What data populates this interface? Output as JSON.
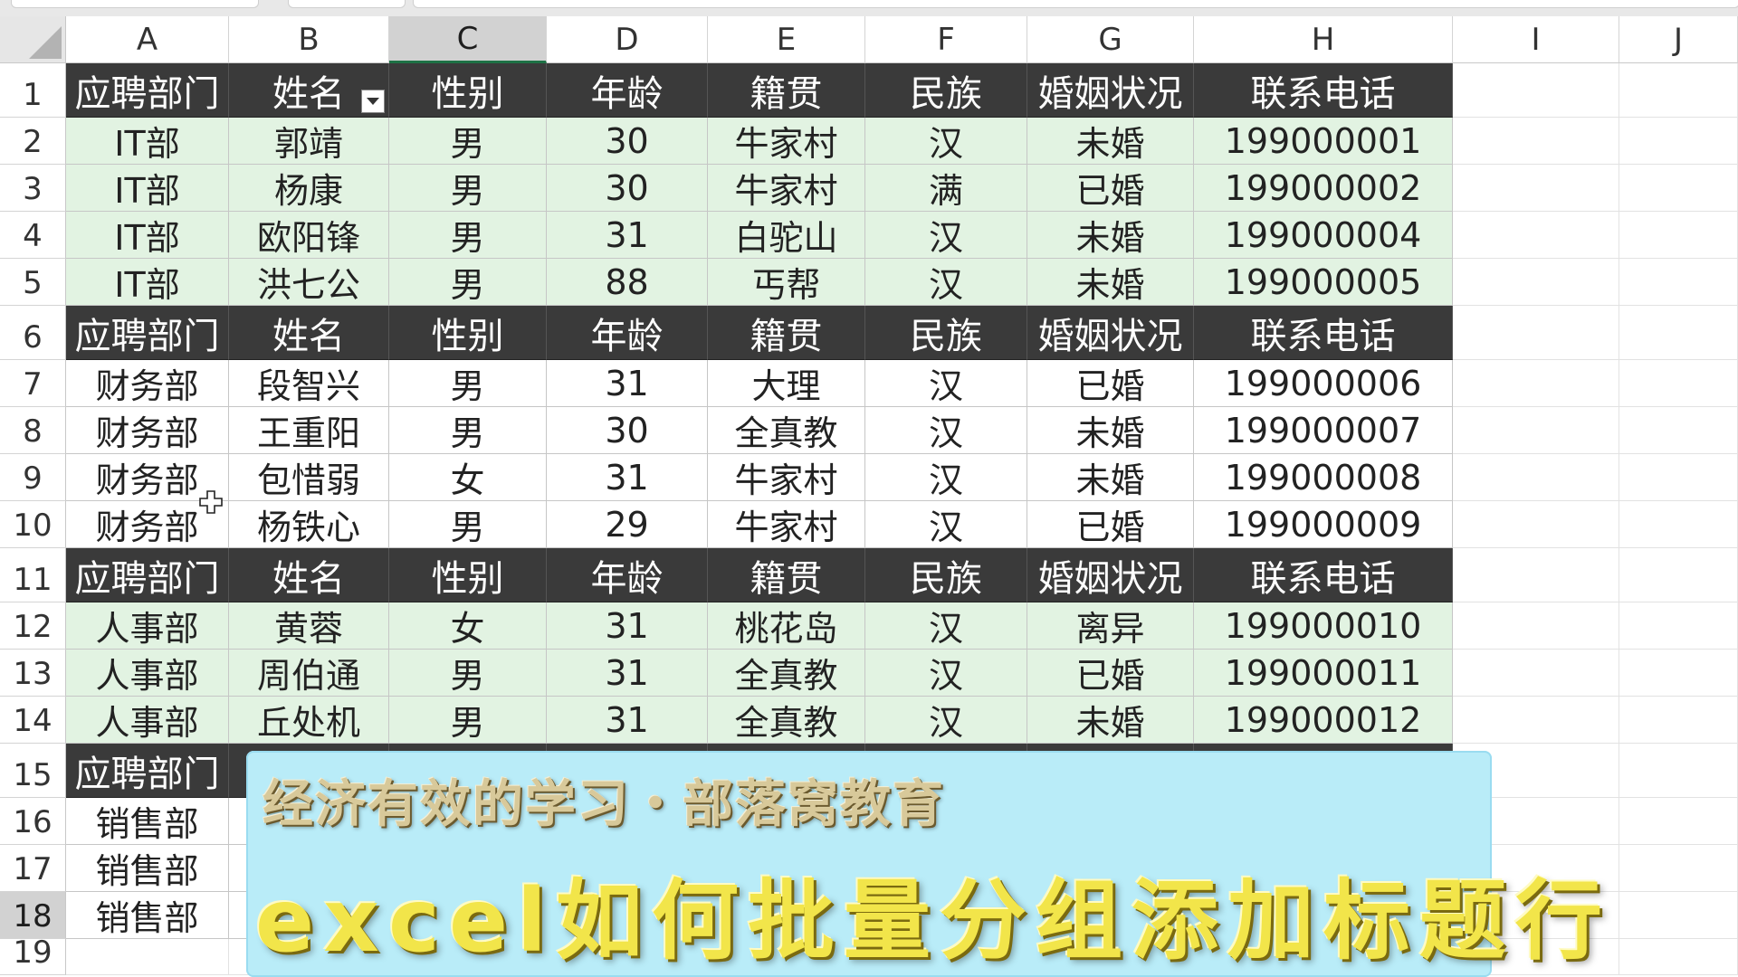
{
  "columns": [
    "A",
    "B",
    "C",
    "D",
    "E",
    "F",
    "G",
    "H",
    "I",
    "J"
  ],
  "selected_column": "C",
  "selected_row": "18",
  "header_labels": [
    "应聘部门",
    "姓名",
    "性别",
    "年龄",
    "籍贯",
    "民族",
    "婚姻状况",
    "联系电话"
  ],
  "filter_column": "B",
  "rows": [
    {
      "num": "1",
      "type": "hdr",
      "cells": [
        "应聘部门",
        "姓名",
        "性别",
        "年龄",
        "籍贯",
        "民族",
        "婚姻状况",
        "联系电话"
      ]
    },
    {
      "num": "2",
      "type": "green",
      "cells": [
        "IT部",
        "郭靖",
        "男",
        "30",
        "牛家村",
        "汉",
        "未婚",
        "199000001"
      ]
    },
    {
      "num": "3",
      "type": "green",
      "cells": [
        "IT部",
        "杨康",
        "男",
        "30",
        "牛家村",
        "满",
        "已婚",
        "199000002"
      ]
    },
    {
      "num": "4",
      "type": "green",
      "cells": [
        "IT部",
        "欧阳锋",
        "男",
        "31",
        "白驼山",
        "汉",
        "未婚",
        "199000004"
      ]
    },
    {
      "num": "5",
      "type": "green",
      "cells": [
        "IT部",
        "洪七公",
        "男",
        "88",
        "丐帮",
        "汉",
        "未婚",
        "199000005"
      ]
    },
    {
      "num": "6",
      "type": "hdr",
      "cells": [
        "应聘部门",
        "姓名",
        "性别",
        "年龄",
        "籍贯",
        "民族",
        "婚姻状况",
        "联系电话"
      ]
    },
    {
      "num": "7",
      "type": "white",
      "cells": [
        "财务部",
        "段智兴",
        "男",
        "31",
        "大理",
        "汉",
        "已婚",
        "199000006"
      ]
    },
    {
      "num": "8",
      "type": "white",
      "cells": [
        "财务部",
        "王重阳",
        "男",
        "30",
        "全真教",
        "汉",
        "未婚",
        "199000007"
      ]
    },
    {
      "num": "9",
      "type": "white",
      "cells": [
        "财务部",
        "包惜弱",
        "女",
        "31",
        "牛家村",
        "汉",
        "未婚",
        "199000008"
      ]
    },
    {
      "num": "10",
      "type": "white",
      "cells": [
        "财务部",
        "杨铁心",
        "男",
        "29",
        "牛家村",
        "汉",
        "已婚",
        "199000009"
      ]
    },
    {
      "num": "11",
      "type": "hdr",
      "cells": [
        "应聘部门",
        "姓名",
        "性别",
        "年龄",
        "籍贯",
        "民族",
        "婚姻状况",
        "联系电话"
      ]
    },
    {
      "num": "12",
      "type": "green",
      "cells": [
        "人事部",
        "黄蓉",
        "女",
        "31",
        "桃花岛",
        "汉",
        "离异",
        "199000010"
      ]
    },
    {
      "num": "13",
      "type": "green",
      "cells": [
        "人事部",
        "周伯通",
        "男",
        "31",
        "全真教",
        "汉",
        "已婚",
        "199000011"
      ]
    },
    {
      "num": "14",
      "type": "green",
      "cells": [
        "人事部",
        "丘处机",
        "男",
        "31",
        "全真教",
        "汉",
        "未婚",
        "199000012"
      ]
    },
    {
      "num": "15",
      "type": "hdr",
      "cells": [
        "应聘部门",
        "",
        "",
        "",
        "",
        "",
        "",
        ""
      ]
    },
    {
      "num": "16",
      "type": "white",
      "cells": [
        "销售部",
        "",
        "",
        "",
        "",
        "",
        "",
        ""
      ]
    },
    {
      "num": "17",
      "type": "white",
      "cells": [
        "销售部",
        "",
        "",
        "",
        "",
        "",
        "",
        ""
      ]
    },
    {
      "num": "18",
      "type": "white",
      "cells": [
        "销售部",
        "",
        "",
        "",
        "",
        "",
        "",
        ""
      ]
    },
    {
      "num": "19",
      "type": "empty",
      "cells": [
        "",
        "",
        "",
        "",
        "",
        "",
        "",
        ""
      ]
    }
  ],
  "banner": {
    "subtitle": "经济有效的学习・部落窝教育",
    "title": "excel如何批量分组添加标题行"
  },
  "colors": {
    "header_bg": "#3a3a3a",
    "green_band": "#e2f3e2",
    "banner_bg": "#b9ecf8",
    "banner_title": "#f2e54a",
    "selection_accent": "#1e7145"
  },
  "icons": {
    "corner": "select-all-triangle-icon",
    "filter": "filter-dropdown-icon",
    "cursor": "cell-select-cross-cursor-icon"
  }
}
